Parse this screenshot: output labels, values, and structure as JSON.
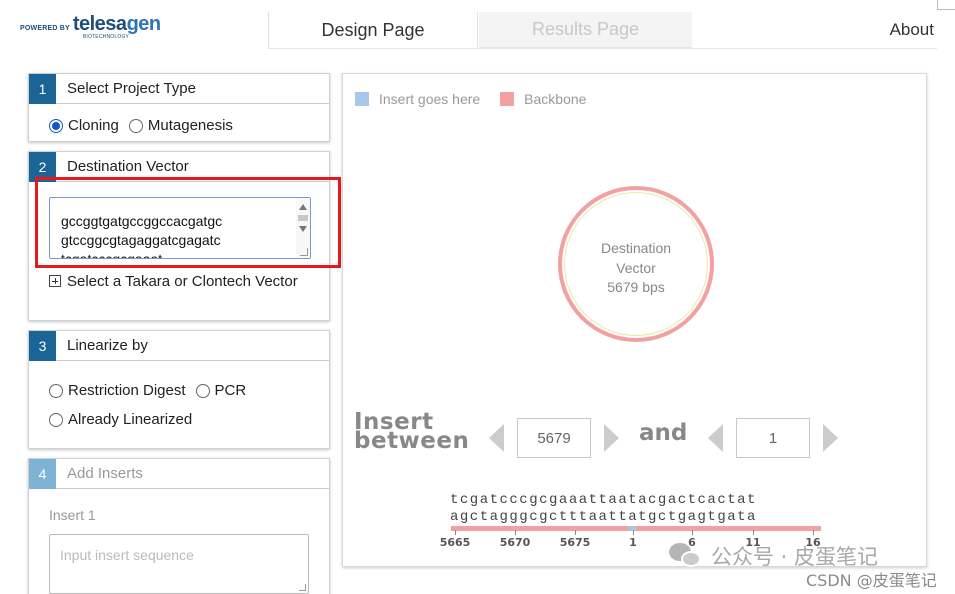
{
  "logo": {
    "powered_by": "POWERED BY",
    "brand_prefix": "telesa",
    "brand_suffix": "gen",
    "sub": "BIOTECHNOLOGY"
  },
  "nav": {
    "design_tab": "Design Page",
    "results_tab": "Results Page",
    "about": "About"
  },
  "step1": {
    "number": "1",
    "title": "Select Project Type",
    "options": [
      {
        "label": "Cloning",
        "checked": true
      },
      {
        "label": "Mutagenesis",
        "checked": false
      }
    ]
  },
  "step2": {
    "number": "2",
    "title": "Destination Vector",
    "sequence_lines": [
      "gccggtgatgccggccacgatgc",
      "gtccggcgtagaggatcgagatc",
      "tcgatcccgcgaaat"
    ],
    "takara_link": "Select a Takara or Clontech Vector"
  },
  "step3": {
    "number": "3",
    "title": "Linearize by",
    "options": [
      {
        "label": "Restriction Digest",
        "checked": false
      },
      {
        "label": "PCR",
        "checked": false
      },
      {
        "label": "Already Linearized",
        "checked": false
      }
    ]
  },
  "step4": {
    "number": "4",
    "title": "Add Inserts",
    "insert_label": "Insert 1",
    "insert_placeholder": "Input insert sequence"
  },
  "legend": {
    "insert": {
      "label": "Insert goes here",
      "color": "#a8c8ea"
    },
    "backbone": {
      "label": "Backbone",
      "color": "#f3a0a0"
    }
  },
  "plasmid": {
    "line1": "Destination",
    "line2": "Vector",
    "line3": "5679 bps"
  },
  "insert_between": {
    "line1": "Insert",
    "line2": "between",
    "start": "5679",
    "and_label": "and",
    "end": "1"
  },
  "sequence_view": {
    "top_strand": "tcgatcccgcgaaattaatacgactcactat",
    "bottom_strand": "agctagggcgctttaattatgctgagtgata",
    "ticks": [
      "5665",
      "5670",
      "5675",
      "1",
      "6",
      "11",
      "16"
    ]
  },
  "watermark": {
    "wechat_text": "公众号 · 皮蛋笔记",
    "csdn_text": "CSDN @皮蛋笔记"
  }
}
